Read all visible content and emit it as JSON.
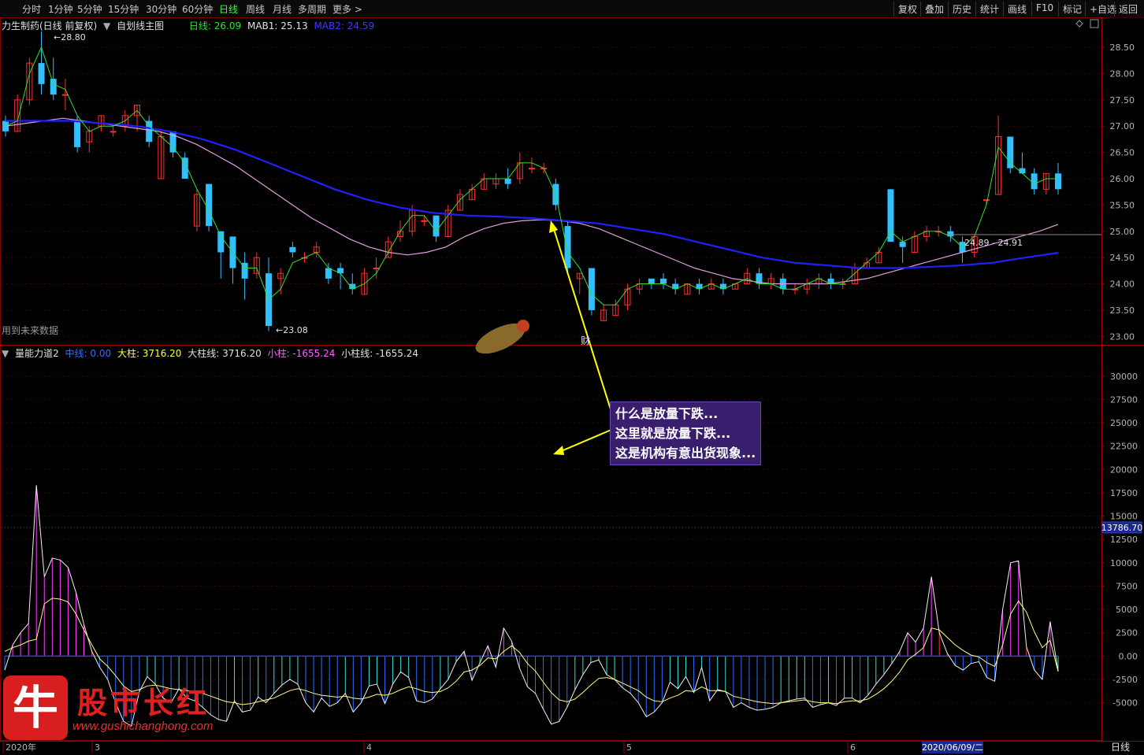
{
  "toolbar": {
    "periods": [
      "分时",
      "1分钟",
      "5分钟",
      "15分钟",
      "30分钟",
      "60分钟",
      "日线",
      "周线",
      "月线",
      "多周期",
      "更多 >"
    ],
    "active_index": 6,
    "right": [
      "复权",
      "叠加",
      "历史",
      "统计",
      "画线",
      "F10",
      "标记",
      "+自选",
      "返回"
    ]
  },
  "main_info": {
    "stock": "力生制药(日线 前复权)",
    "template": "自划线主图",
    "line_label": "日线: 26.09",
    "mab1": "MAB1: 25.13",
    "mab2": "MAB2: 24.59"
  },
  "main_notes": {
    "high_label": "28.80",
    "low_label": "23.08",
    "range_label": "24.89 - 24.91",
    "future": "用到未来数据",
    "cai": "财"
  },
  "sub_info": {
    "name": "量能力道2",
    "mid": "中线: 0.00",
    "big": "大柱: 3716.20",
    "big_line": "大柱线: 3716.20",
    "small": "小柱: -1655.24",
    "small_line": "小柱线: -1655.24"
  },
  "annotation": [
    "什么是放量下跌...",
    "这里就是放量下跌...",
    "这是机构有意出货现象..."
  ],
  "price_axis": [
    "28.50",
    "28.00",
    "27.50",
    "27.00",
    "26.50",
    "26.00",
    "25.50",
    "25.00",
    "24.50",
    "24.00",
    "23.50",
    "23.00"
  ],
  "sub_axis": [
    "30000",
    "27500",
    "25000",
    "22500",
    "20000",
    "17500",
    "15000",
    "12500",
    "10000",
    "7500",
    "5000",
    "2500",
    "0.00",
    "-2500",
    "-5000"
  ],
  "crosshair_value": "13786.70",
  "dates": [
    "2020年",
    "3",
    "4",
    "5",
    "6"
  ],
  "date_cursor": "2020/06/09/二",
  "period_btn": "日线",
  "watermark": {
    "cn": "股市长红",
    "url": "www.gushichanghong.com",
    "logo": "牛"
  },
  "colors": {
    "up": "#ff3030",
    "down": "#30c0ff",
    "ma_fast": "#30e030",
    "mab1": "#e0a0e0",
    "mab2": "#2020ff",
    "grid": "#400000",
    "arrow": "#ffff00"
  },
  "chart_data": [
    {
      "type": "candlestick",
      "title": "力生制药(日线 前复权)",
      "ylim": [
        22.9,
        28.8
      ],
      "ohlc": [
        [
          27.1,
          27.2,
          26.8,
          26.9
        ],
        [
          26.9,
          27.6,
          26.9,
          27.5
        ],
        [
          27.5,
          28.3,
          27.4,
          28.2
        ],
        [
          28.2,
          28.8,
          27.6,
          27.8
        ],
        [
          27.9,
          28.3,
          27.5,
          27.6
        ],
        [
          27.6,
          27.9,
          27.3,
          27.6
        ],
        [
          27.1,
          27.2,
          26.5,
          26.6
        ],
        [
          26.7,
          27.0,
          26.5,
          26.9
        ],
        [
          27.0,
          27.2,
          26.9,
          27.2
        ],
        [
          26.9,
          27.0,
          26.8,
          26.9
        ],
        [
          27.0,
          27.3,
          26.9,
          27.2
        ],
        [
          27.2,
          27.4,
          26.9,
          27.4
        ],
        [
          27.1,
          27.2,
          26.6,
          26.7
        ],
        [
          26.0,
          26.9,
          26.0,
          26.8
        ],
        [
          26.9,
          26.9,
          26.4,
          26.5
        ],
        [
          26.4,
          26.5,
          26.0,
          26.0
        ],
        [
          25.1,
          25.8,
          25.0,
          25.7
        ],
        [
          25.9,
          25.9,
          25.0,
          25.1
        ],
        [
          25.0,
          25.0,
          24.1,
          24.6
        ],
        [
          24.9,
          24.9,
          24.0,
          24.3
        ],
        [
          24.4,
          24.6,
          23.7,
          24.1
        ],
        [
          24.2,
          24.6,
          24.1,
          24.5
        ],
        [
          24.2,
          24.5,
          23.1,
          23.2
        ],
        [
          24.1,
          24.3,
          23.8,
          24.2
        ],
        [
          24.7,
          24.8,
          24.5,
          24.6
        ],
        [
          24.5,
          24.6,
          24.4,
          24.5
        ],
        [
          24.6,
          24.8,
          24.5,
          24.7
        ],
        [
          24.3,
          24.4,
          24.0,
          24.1
        ],
        [
          24.3,
          24.4,
          23.9,
          24.2
        ],
        [
          24.0,
          24.2,
          23.8,
          23.9
        ],
        [
          23.8,
          24.3,
          23.8,
          24.2
        ],
        [
          24.3,
          24.5,
          24.1,
          24.3
        ],
        [
          24.5,
          24.9,
          24.5,
          24.8
        ],
        [
          24.9,
          25.2,
          24.8,
          25.0
        ],
        [
          25.0,
          25.5,
          24.9,
          25.4
        ],
        [
          25.2,
          25.3,
          25.1,
          25.2
        ],
        [
          25.3,
          25.3,
          24.8,
          24.9
        ],
        [
          24.9,
          25.5,
          24.9,
          25.4
        ],
        [
          25.4,
          25.8,
          25.4,
          25.7
        ],
        [
          25.6,
          25.9,
          25.6,
          25.8
        ],
        [
          25.8,
          26.1,
          25.8,
          26.0
        ],
        [
          25.9,
          26.1,
          25.8,
          26.0
        ],
        [
          26.0,
          26.2,
          25.8,
          25.9
        ],
        [
          26.0,
          26.5,
          25.9,
          26.3
        ],
        [
          26.2,
          26.4,
          26.1,
          26.2
        ],
        [
          26.2,
          26.3,
          26.1,
          26.2
        ],
        [
          25.9,
          26.0,
          25.4,
          25.5
        ],
        [
          25.1,
          25.2,
          24.2,
          24.3
        ],
        [
          24.1,
          24.2,
          23.8,
          24.2
        ],
        [
          24.3,
          24.3,
          23.4,
          23.5
        ],
        [
          23.3,
          23.6,
          23.3,
          23.5
        ],
        [
          23.4,
          23.7,
          23.4,
          23.6
        ],
        [
          23.6,
          24.0,
          23.5,
          23.9
        ],
        [
          23.9,
          24.1,
          23.8,
          24.0
        ],
        [
          24.1,
          24.1,
          23.9,
          24.0
        ],
        [
          24.1,
          24.2,
          23.9,
          24.0
        ],
        [
          24.0,
          24.1,
          23.8,
          23.9
        ],
        [
          23.8,
          24.0,
          23.8,
          24.0
        ],
        [
          24.0,
          24.1,
          23.8,
          23.9
        ],
        [
          23.9,
          24.1,
          23.9,
          24.0
        ],
        [
          24.0,
          24.1,
          23.8,
          23.9
        ],
        [
          23.9,
          24.0,
          23.9,
          24.0
        ],
        [
          24.0,
          24.3,
          24.0,
          24.2
        ],
        [
          24.2,
          24.3,
          23.9,
          24.0
        ],
        [
          24.0,
          24.2,
          23.9,
          24.1
        ],
        [
          24.1,
          24.2,
          23.8,
          23.9
        ],
        [
          23.9,
          24.0,
          23.8,
          23.9
        ],
        [
          23.9,
          24.1,
          23.8,
          24.0
        ],
        [
          24.0,
          24.2,
          23.9,
          24.1
        ],
        [
          24.1,
          24.2,
          23.9,
          24.0
        ],
        [
          24.0,
          24.1,
          23.9,
          24.0
        ],
        [
          24.0,
          24.4,
          24.0,
          24.3
        ],
        [
          24.3,
          24.5,
          24.3,
          24.4
        ],
        [
          24.4,
          24.7,
          24.4,
          24.6
        ],
        [
          25.8,
          25.8,
          24.8,
          24.8
        ],
        [
          24.8,
          24.9,
          24.4,
          24.7
        ],
        [
          24.6,
          25.0,
          24.6,
          24.9
        ],
        [
          24.9,
          25.1,
          24.8,
          25.0
        ],
        [
          25.0,
          25.1,
          24.9,
          25.0
        ],
        [
          25.0,
          25.1,
          24.8,
          24.9
        ],
        [
          24.8,
          24.9,
          24.4,
          24.6
        ],
        [
          24.6,
          24.9,
          24.5,
          24.9
        ],
        [
          25.6,
          25.6,
          25.5,
          25.6
        ],
        [
          25.7,
          27.2,
          25.7,
          26.8
        ],
        [
          26.8,
          26.8,
          26.1,
          26.2
        ],
        [
          26.2,
          26.5,
          26.1,
          26.1
        ],
        [
          26.1,
          26.2,
          25.7,
          25.8
        ],
        [
          25.8,
          26.1,
          25.7,
          26.1
        ],
        [
          26.1,
          26.3,
          25.7,
          25.8
        ]
      ],
      "series": [
        {
          "name": "日线",
          "values": [
            27.0,
            27.1,
            28.0,
            28.5,
            27.8,
            27.7,
            27.2,
            26.9,
            27.0,
            27.0,
            27.1,
            27.3,
            27.0,
            26.8,
            26.6,
            26.3,
            25.8,
            25.4,
            24.9,
            24.6,
            24.3,
            24.3,
            23.7,
            23.9,
            24.4,
            24.5,
            24.6,
            24.3,
            24.2,
            23.9,
            24.0,
            24.2,
            24.6,
            25.0,
            25.3,
            25.3,
            25.0,
            25.3,
            25.6,
            25.8,
            26.0,
            26.0,
            26.0,
            26.3,
            26.3,
            26.2,
            25.7,
            24.6,
            24.3,
            23.8,
            23.6,
            23.6,
            23.9,
            24.0,
            24.0,
            24.0,
            23.9,
            24.0,
            23.9,
            24.0,
            23.9,
            24.0,
            24.1,
            24.0,
            24.0,
            23.9,
            23.9,
            24.0,
            24.1,
            24.0,
            24.0,
            24.2,
            24.4,
            24.6,
            25.0,
            24.8,
            24.9,
            25.0,
            25.0,
            24.9,
            24.7,
            24.9,
            25.5,
            26.6,
            26.3,
            26.1,
            25.9,
            26.0,
            26.0
          ]
        },
        {
          "name": "MAB1",
          "values": [
            27.0,
            27.05,
            27.1,
            27.15,
            27.1,
            27.05,
            27.0,
            26.95,
            26.9,
            26.8,
            26.65,
            26.45,
            26.25,
            26.0,
            25.75,
            25.5,
            25.25,
            25.05,
            24.85,
            24.7,
            24.6,
            24.55,
            24.6,
            24.7,
            24.9,
            25.05,
            25.15,
            25.2,
            25.22,
            25.2,
            25.15,
            25.05,
            24.9,
            24.75,
            24.6,
            24.45,
            24.3,
            24.2,
            24.1,
            24.05,
            24.0,
            24.0,
            24.0,
            24.0,
            24.05,
            24.1,
            24.2,
            24.3,
            24.4,
            24.5,
            24.6,
            24.7,
            24.8,
            24.9,
            25.0,
            25.13
          ]
        },
        {
          "name": "MAB2",
          "values": [
            27.1,
            27.1,
            27.1,
            27.05,
            27.0,
            26.9,
            26.75,
            26.55,
            26.3,
            26.05,
            25.8,
            25.6,
            25.45,
            25.35,
            25.3,
            25.28,
            25.25,
            25.2,
            25.15,
            25.05,
            24.95,
            24.8,
            24.65,
            24.5,
            24.4,
            24.35,
            24.3,
            24.3,
            24.32,
            24.35,
            24.4,
            24.5,
            24.59
          ]
        }
      ]
    },
    {
      "type": "bar",
      "title": "量能力道2",
      "ylim": [
        -9000,
        31500
      ],
      "series": [
        {
          "name": "大柱",
          "values": [
            -1500,
            1200,
            2500,
            3500,
            18300,
            8500,
            10500,
            10300,
            9500,
            6800,
            3400,
            500,
            -1200,
            -2500,
            -5000,
            -7000,
            -7500,
            -3800,
            -2200,
            -3000,
            -4500,
            -5000,
            -3500,
            -4500,
            -4800,
            -5500,
            -6300,
            -6800,
            -7000,
            -4800,
            -6000,
            -5800,
            -4400,
            -5000,
            -4000,
            -3100,
            -2500,
            -3000,
            -5000,
            -6000,
            -4500,
            -5400,
            -5000,
            -4000,
            -6000,
            -5000,
            -3200,
            -3000,
            -5100,
            -3000,
            -1700,
            -2300,
            -4800,
            -5000,
            -4600,
            -3500,
            -2500,
            -600,
            500,
            -2600,
            -700,
            1100,
            -1200,
            3000,
            1600,
            -1300,
            -3300,
            -4000,
            -5700,
            -7300,
            -7000,
            -5500,
            -3600,
            -2000,
            -700,
            -400,
            -2000,
            -2500,
            -3400,
            -4000,
            -5000,
            -6500,
            -6000,
            -5000,
            -2800,
            -3500,
            -2200,
            -3900,
            -1200,
            -4800,
            -3600,
            -3800,
            -5500,
            -5000,
            -5500,
            -5800,
            -5700,
            -5500,
            -5000,
            -4800,
            -4600,
            -4500,
            -5500,
            -5200,
            -5000,
            -5300,
            -4500,
            -4500,
            -5000,
            -4200,
            -3000,
            -2000,
            -800,
            500,
            2500,
            1500,
            3000,
            8500,
            2500,
            300,
            -1000,
            -1500,
            -800,
            -600,
            -2300,
            -2700,
            5000,
            10000,
            10200,
            1000,
            -1500,
            -2500,
            3700,
            -1655
          ]
        },
        {
          "name": "小柱",
          "values": [
            500,
            900,
            1200,
            1600,
            1800,
            5600,
            6200,
            6100,
            5800,
            4500,
            2800,
            1200,
            -300,
            -1100,
            -2100,
            -3200,
            -3800,
            -3600,
            -3200,
            -3100,
            -3300,
            -3500,
            -3600,
            -3700,
            -3800,
            -4000,
            -4300,
            -4600,
            -4900,
            -5000,
            -5200,
            -5100,
            -4900,
            -4700,
            -4500,
            -4100,
            -3700,
            -3500,
            -3700,
            -4000,
            -4200,
            -4300,
            -4400,
            -4300,
            -4500,
            -4600,
            -4400,
            -4100,
            -4200,
            -4000,
            -3600,
            -3300,
            -3500,
            -3800,
            -3900,
            -3800,
            -3400,
            -2700,
            -1700,
            -1500,
            -1000,
            -200,
            -300,
            500,
            1100,
            400,
            -800,
            -1600,
            -2800,
            -3900,
            -4700,
            -4900,
            -4600,
            -3900,
            -3100,
            -2400,
            -2300,
            -2500,
            -2900,
            -3300,
            -3700,
            -4400,
            -4800,
            -4900,
            -4500,
            -4200,
            -3700,
            -3800,
            -3300,
            -3700,
            -3700,
            -3800,
            -4300,
            -4500,
            -4700,
            -4900,
            -5000,
            -5100,
            -5000,
            -4900,
            -4800,
            -4700,
            -4900,
            -5000,
            -5000,
            -5100,
            -4900,
            -4800,
            -4800,
            -4600,
            -4100,
            -3500,
            -2700,
            -1700,
            -400,
            200,
            900,
            3000,
            2800,
            2000,
            1200,
            600,
            100,
            -100,
            -700,
            -1100,
            1200,
            4500,
            5900,
            4700,
            2600,
            900,
            1700,
            -1655
          ]
        }
      ]
    }
  ]
}
